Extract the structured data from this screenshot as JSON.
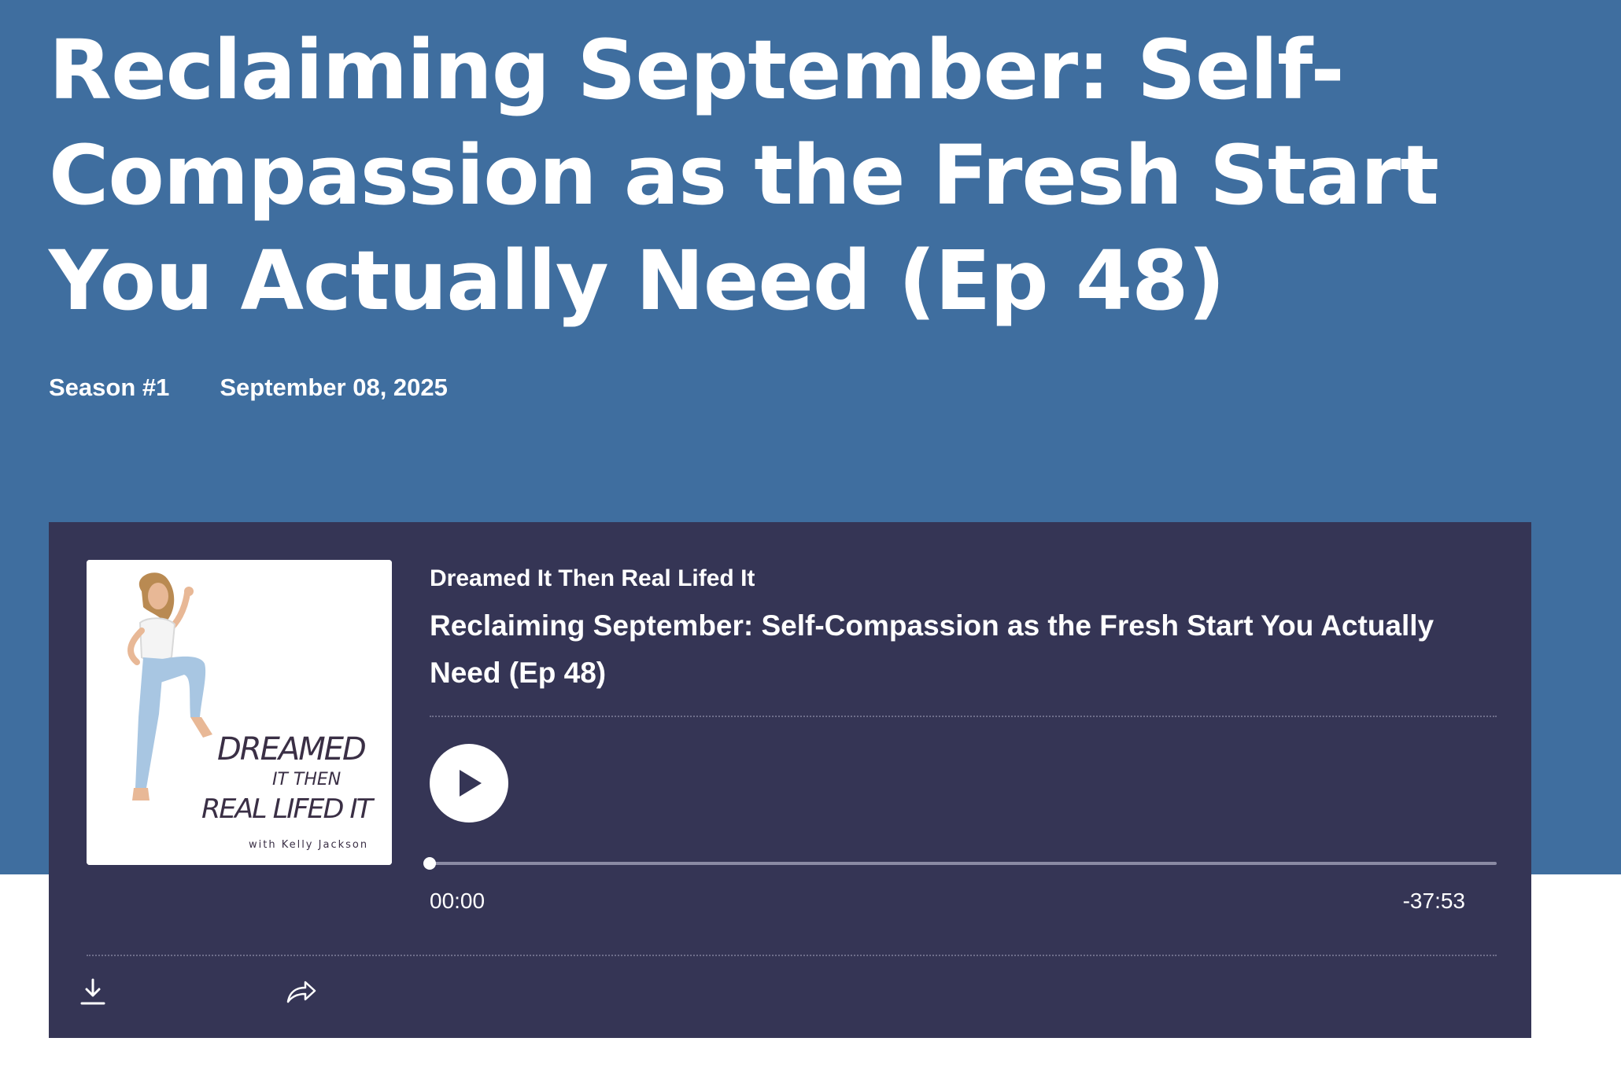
{
  "episode": {
    "title": "Reclaiming September: Self-Compassion as the Fresh Start You Actually Need (Ep 48)",
    "season": "Season #1",
    "date": "September 08, 2025"
  },
  "player": {
    "show_name": "Dreamed It Then Real Lifed It",
    "episode_title": "Reclaiming September: Self-Compassion as the Fresh Start You Actually Need (Ep 48)",
    "elapsed": "00:00",
    "remaining": "-37:53",
    "progress": 0,
    "play_icon": "play-icon",
    "download_icon": "download-icon",
    "share_icon": "share-icon"
  },
  "cover_art": {
    "line1": "DREAMED",
    "line2": "IT THEN",
    "line3": "REAL LIFED IT",
    "byline": "with Kelly Jackson"
  },
  "colors": {
    "hero_background": "#3f6e9f",
    "player_background": "#353555",
    "cover_text": "#3a2f45"
  }
}
